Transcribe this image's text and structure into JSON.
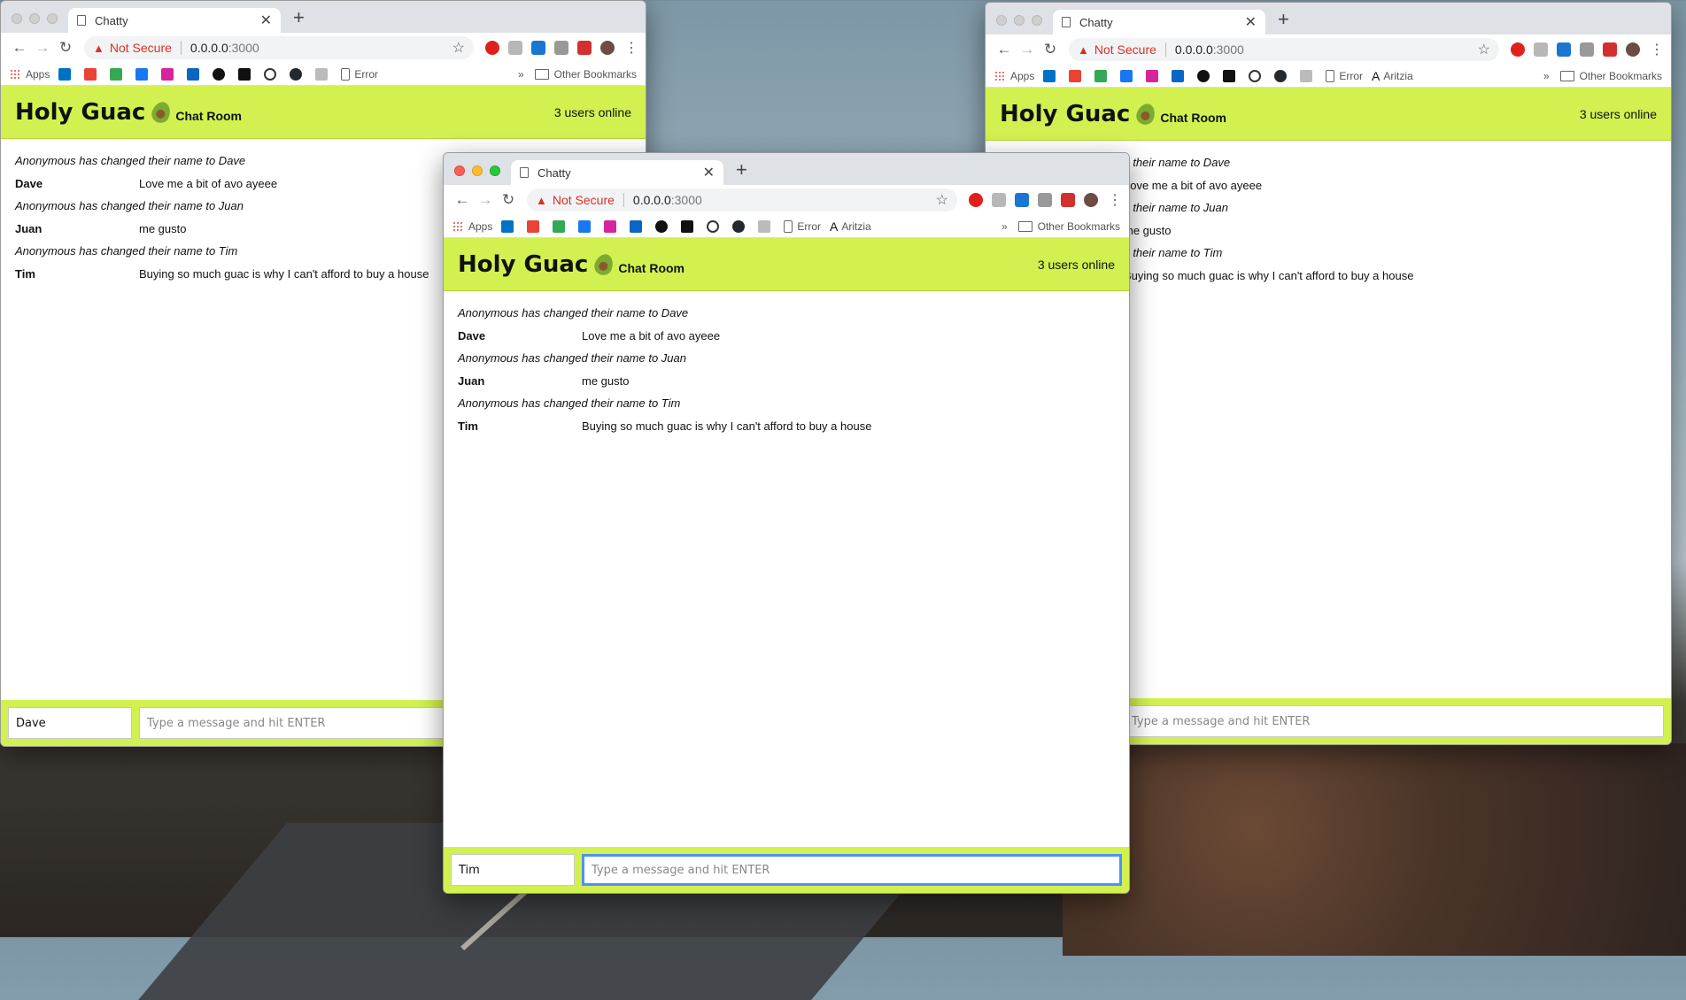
{
  "browser": {
    "tab_title": "Chatty",
    "security_label": "Not Secure",
    "host": "0.0.0.0",
    "port": ":3000",
    "bookmarks": {
      "apps": "Apps",
      "error": "Error",
      "aritzia": "Aritzia",
      "more": "»",
      "other": "Other Bookmarks"
    }
  },
  "app": {
    "brand": "Holy Guac",
    "subtitle": "Chat Room",
    "online_count": "3 users online",
    "message_placeholder": "Type a message and hit ENTER"
  },
  "messages": [
    {
      "type": "system",
      "text": "Anonymous has changed their name to Dave"
    },
    {
      "type": "chat",
      "user": "Dave",
      "text": "Love me a bit of avo ayeee"
    },
    {
      "type": "system",
      "text": "Anonymous has changed their name to Juan"
    },
    {
      "type": "chat",
      "user": "Juan",
      "text": "me gusto"
    },
    {
      "type": "system",
      "text": "Anonymous has changed their name to Tim"
    },
    {
      "type": "chat",
      "user": "Tim",
      "text": "Buying so much guac is why I can't afford to buy a house"
    }
  ],
  "windows": {
    "left": {
      "username": "Dave"
    },
    "right": {
      "username": ""
    },
    "center": {
      "username": "Tim"
    }
  },
  "colors": {
    "header_bg": "#d2f151",
    "accent_focus": "#4d90fe",
    "not_secure": "#d93025"
  }
}
